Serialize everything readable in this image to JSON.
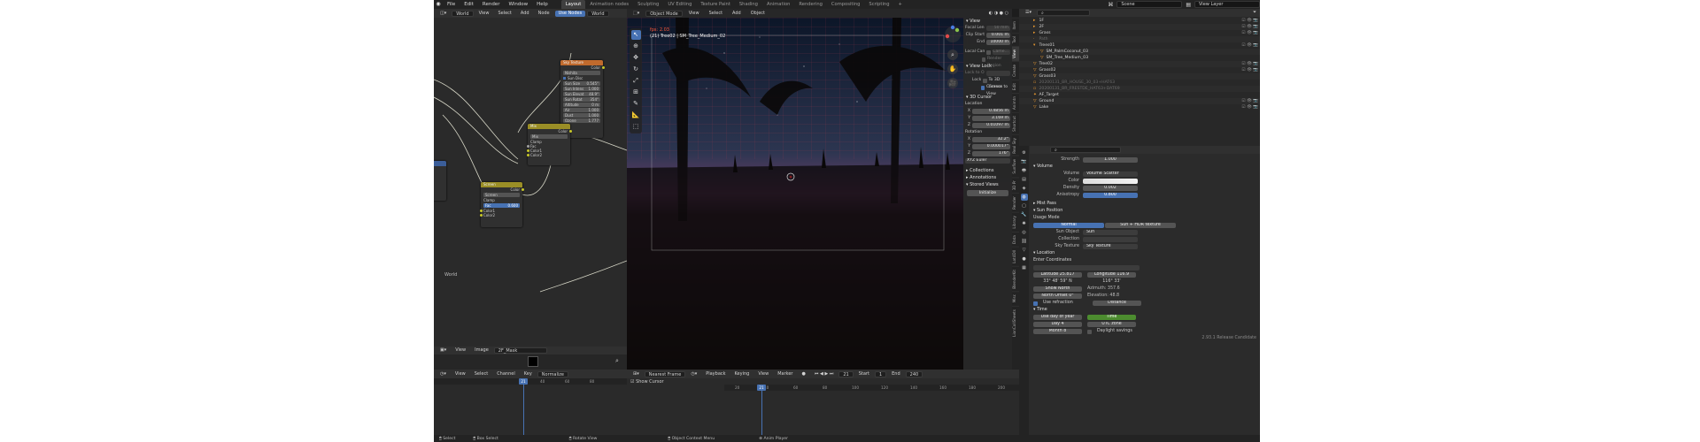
{
  "topbar": {
    "menus": [
      "File",
      "Edit",
      "Render",
      "Window",
      "Help"
    ],
    "workspaces": [
      "Layout",
      "Animation nodes",
      "Sculpting",
      "UV Editing",
      "Texture Paint",
      "Shading",
      "Animation",
      "Rendering",
      "Compositing",
      "Scripting"
    ],
    "active_workspace": "Layout",
    "add_tab": "+",
    "scene": "Scene",
    "view_layer": "View Layer"
  },
  "node_editor": {
    "header": [
      "World",
      "View",
      "Select",
      "Add",
      "Node"
    ],
    "use_nodes": "Use Nodes",
    "world_field": "World",
    "label": "World",
    "sky_node": {
      "title": "Sky Texture",
      "out": "Color",
      "type": "Nishita",
      "sun_disc": "Sun Disc",
      "rows": [
        [
          "Sun Size",
          "0.545°"
        ],
        [
          "Sun Intens",
          "1.000"
        ],
        [
          "Sun Elevat",
          "48.9°"
        ],
        [
          "Sun Rotat",
          "354°"
        ],
        [
          "Altitude",
          "0 m"
        ],
        [
          "Air",
          "1.000"
        ],
        [
          "Dust",
          "1.000"
        ],
        [
          "Ozone",
          "1.777"
        ]
      ]
    },
    "mix_node": {
      "title": "Mix",
      "out": "Color",
      "mode": "Mix",
      "clamp": "Clamp",
      "inputs": [
        "Fac",
        "Color1",
        "Color2"
      ]
    },
    "mix2_node": {
      "title": "Screen",
      "out": "Color",
      "mode": "Screen",
      "clamp": "Clamp",
      "fac": "Fac",
      "fac_val": "0.600",
      "inputs": [
        "Color1",
        "Color2"
      ]
    }
  },
  "image_editor": {
    "header": [
      "View",
      "Image"
    ],
    "image": "2F_Mask"
  },
  "viewport": {
    "mode": "Object Mode",
    "menus": [
      "View",
      "Select",
      "Add",
      "Object"
    ],
    "transform": "Global",
    "options": "Options",
    "fps": "fps: 2.03",
    "object_info": "(21) Tree02 | SM_Tree_Medium_02"
  },
  "n_panel": {
    "view_title": "View",
    "focal_length": {
      "label": "Focal Length",
      "value": "50 mm"
    },
    "clip_start": {
      "label": "Clip Start",
      "value": "0.001 m"
    },
    "clip_end": {
      "label": "End",
      "value": "10000 m"
    },
    "local_camera": "Local Camera",
    "camera_field": "Came...",
    "render_region": "Render Region",
    "view_lock": "View Lock",
    "lock_to_object": "Lock to Obje",
    "lock": "Lock",
    "to_3d_cursor": "To 3D Cursor",
    "camera_to_view": "Camera to View",
    "cursor_title": "3D Cursor",
    "location": "Location",
    "loc_x": {
      "label": "X",
      "value": "0.4856 m"
    },
    "loc_y": {
      "label": "Y",
      "value": "3.169 m"
    },
    "loc_z": {
      "label": "Z",
      "value": "0.01097 m"
    },
    "rotation": "Rotation",
    "rot_x": {
      "label": "X",
      "value": "32.2°"
    },
    "rot_y": {
      "label": "Y",
      "value": "0.000017°"
    },
    "rot_z": {
      "label": "Z",
      "value": "176°"
    },
    "rot_mode": "XYZ Euler",
    "collections": "Collections",
    "annotations": "Annotations",
    "stored_views": "Stored Views",
    "initialize": "Initialize",
    "tabs": [
      "Item",
      "Tool",
      "View",
      "Create",
      "Edit",
      "Animtn",
      "Shortcut",
      "Real Sky",
      "Sunflow",
      "3D Pr",
      "Render",
      "Library",
      "Data",
      "Lot4Dll",
      "BlenderKit",
      "Misc",
      "LionCollSheets"
    ]
  },
  "outliner": {
    "rows": [
      {
        "name": "1F",
        "icon": "collection",
        "dim": false
      },
      {
        "name": "2F",
        "icon": "collection",
        "dim": false
      },
      {
        "name": "Grass",
        "icon": "collection",
        "dim": false
      },
      {
        "name": "Path",
        "icon": "object",
        "dim": true
      },
      {
        "name": "Trees01",
        "icon": "mesh",
        "dim": false
      },
      {
        "name": "SM_PalmCoconut_03",
        "icon": "mesh",
        "dim": false
      },
      {
        "name": "SM_Tree_Medium_03",
        "icon": "mesh",
        "dim": false
      },
      {
        "name": "Tree02",
        "icon": "mesh",
        "dim": false
      },
      {
        "name": "Grass02",
        "icon": "mesh",
        "dim": false
      },
      {
        "name": "Grass03",
        "icon": "mesh",
        "dim": false
      },
      {
        "name": "20200131_BR_HOUSE_30_03+HAT63",
        "icon": "image",
        "dim": true
      },
      {
        "name": "20200131_BR_FRESTDE_HAT63+DAT69",
        "icon": "image",
        "dim": true
      },
      {
        "name": "AF_Target",
        "icon": "empty",
        "dim": false
      },
      {
        "name": "Ground",
        "icon": "mesh",
        "dim": false
      },
      {
        "name": "Lake",
        "icon": "mesh",
        "dim": false
      }
    ]
  },
  "properties": {
    "strength": {
      "label": "Strength",
      "value": "1.000"
    },
    "volume_title": "Volume",
    "volume": {
      "label": "Volume",
      "value": "Volume Scatter"
    },
    "color_label": "Color",
    "density": {
      "label": "Density",
      "value": "0.002"
    },
    "anisotropy": {
      "label": "Anisotropy",
      "value": "0.800"
    },
    "mist_pass": "Mist Pass",
    "sun_position": "Sun Position",
    "usage_mode": "Usage Mode",
    "mode_normal": "Normal",
    "mode_hdri": "Sun + HDR texture",
    "sun_object": {
      "label": "Sun Object",
      "value": "Sun"
    },
    "collection": {
      "label": "Collection",
      "value": ""
    },
    "sky_texture": {
      "label": "Sky Texture",
      "value": "Sky Texture"
    },
    "location_sec": "Location",
    "enter_coords": "Enter Coordinates",
    "latitude": {
      "label": "Latitude",
      "value": "25.817"
    },
    "longitude": {
      "label": "Longitude",
      "value": "116.9"
    },
    "lat_dms": "33° 48' 59\" N",
    "lon_dms": "116° 33'",
    "show_north": "Show North",
    "north_offset": {
      "label": "North Offset",
      "value": "0°"
    },
    "azimuth": "Azimuth: 357.6",
    "elevation": "Elevation: 48.8",
    "use_refraction": "Use refraction",
    "distance": "Distance",
    "time_sec": "Time",
    "use_day_of_year": "Use day of year",
    "time": "Time",
    "utc_zone": "UTC zone",
    "day": {
      "label": "Day",
      "value": "4"
    },
    "month": {
      "label": "Month",
      "value": "8"
    },
    "daylight_savings": "Daylight savings",
    "version": "2.93.1 Release Candidate"
  },
  "dopesheet": {
    "header": [
      "View",
      "Select",
      "Channel",
      "Key"
    ],
    "mode": "Normalize",
    "ruler": [
      "40",
      "60",
      "80"
    ],
    "playhead": "21"
  },
  "timeline": {
    "interp": "Nearest Frame",
    "menus": [
      "Playback",
      "Keying",
      "View",
      "Marker"
    ],
    "show_cursor": "Show Cursor",
    "current": "21",
    "start_label": "Start",
    "start": "1",
    "end_label": "End",
    "end": "240",
    "ruler": [
      "20",
      "40",
      "60",
      "80",
      "100",
      "120",
      "140",
      "160",
      "180",
      "200"
    ]
  },
  "statusbar": {
    "items": [
      "Select",
      "Box Select",
      "Rotate View",
      "Object Context Menu",
      "Anim Player"
    ]
  }
}
